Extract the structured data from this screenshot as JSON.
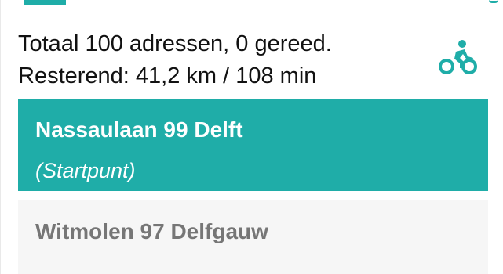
{
  "summary": {
    "line1": "Totaal 100 adressen, 0 gereed.",
    "line2": "Resterend: 41,2 km / 108 min"
  },
  "travel_mode_icon": "bicycle-icon",
  "stops": [
    {
      "address": "Nassaulaan 99 Delft",
      "note": "(Startpunt)",
      "state": "selected"
    },
    {
      "address": "Witmolen 97 Delfgauw"
    }
  ],
  "colors": {
    "accent": "#1fada8",
    "row_background": "#f6f6f6",
    "row_text_muted": "#767676"
  }
}
